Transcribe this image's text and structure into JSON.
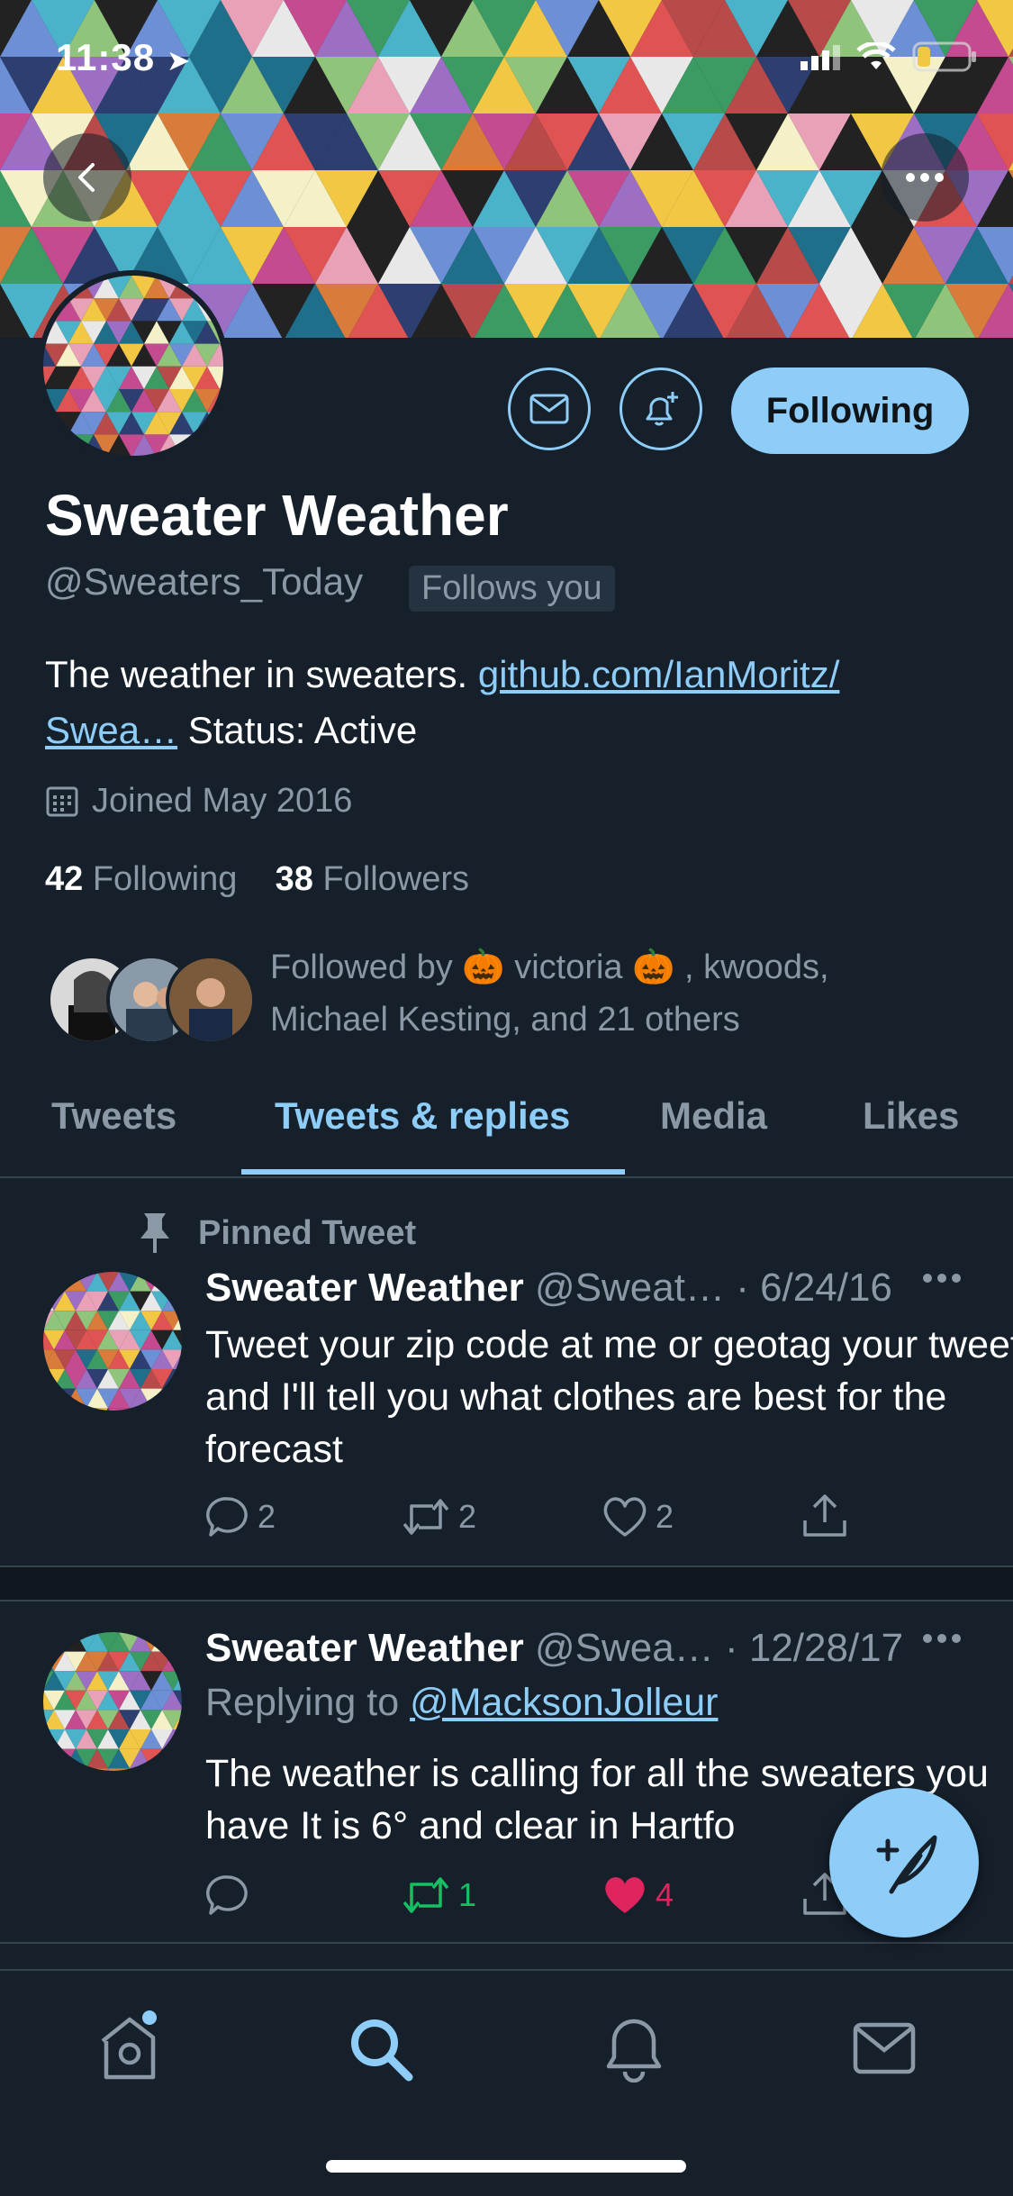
{
  "status_bar": {
    "time": "11:38"
  },
  "profile": {
    "name": "Sweater Weather",
    "handle": "@Sweaters_Today",
    "follows_you": "Follows you",
    "following_button": "Following",
    "bio_text": "The weather in sweaters. ",
    "bio_link_1": "github.com/IanMoritz/",
    "bio_link_2": "Swea…",
    "bio_status": " Status: Active",
    "joined": "Joined May 2016",
    "following_count": "42",
    "following_label": "Following",
    "followers_count": "38",
    "followers_label": "Followers",
    "followed_by_line1": "Followed by 🎃 victoria 🎃 , kwoods,",
    "followed_by_line2": "Michael Kesting, and 21 others"
  },
  "tabs": [
    {
      "label": "Tweets"
    },
    {
      "label": "Tweets & replies",
      "active": true
    },
    {
      "label": "Media"
    },
    {
      "label": "Likes"
    }
  ],
  "tweets": [
    {
      "pinned_label": "Pinned Tweet",
      "name": "Sweater Weather",
      "meta": " @Sweat… · 6/24/16",
      "text": "Tweet your zip code at me or geotag your tweet and I'll tell you what clothes are best for the forecast",
      "replies": "2",
      "retweets": "2",
      "likes": "2"
    },
    {
      "name": "Sweater Weather",
      "meta": " @Swea… · 12/28/17",
      "replying_prefix": "Replying to ",
      "replying_to": "@MacksonJolleur",
      "text": "The weather is calling for all the sweaters you have It is 6° and clear in Hartfo",
      "replies": "",
      "retweets": "1",
      "likes": "4"
    }
  ],
  "colors": {
    "accent": "#8ecdf8",
    "background": "#15202b",
    "retweet": "#17bf63",
    "like": "#e0245e"
  },
  "icons": [
    "back-icon",
    "more-icon",
    "mail-icon",
    "bell-add-icon",
    "calendar-icon",
    "pin-icon",
    "reply-icon",
    "retweet-icon",
    "like-icon",
    "share-icon",
    "compose-icon",
    "home-icon",
    "search-icon",
    "notifications-icon",
    "messages-icon"
  ]
}
